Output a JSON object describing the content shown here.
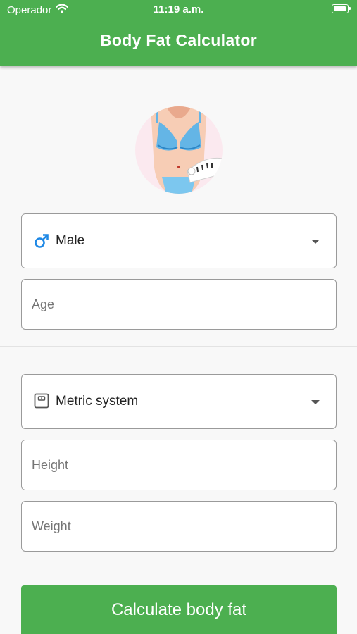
{
  "status_bar": {
    "carrier": "Operador",
    "time": "11:19 a.m.",
    "wifi_icon": "wifi-icon",
    "battery_icon": "battery-icon"
  },
  "header": {
    "title": "Body Fat Calculator",
    "color": "#4caf50"
  },
  "avatar": {
    "icon": "body-measure-illustration"
  },
  "gender_select": {
    "value": "Male",
    "icon": "male-symbol-icon",
    "icon_color": "#1e88e5"
  },
  "age_field": {
    "placeholder": "Age",
    "value": ""
  },
  "units_select": {
    "value": "Metric system",
    "icon": "scale-icon"
  },
  "height_field": {
    "placeholder": "Height",
    "value": ""
  },
  "weight_field": {
    "placeholder": "Weight",
    "value": ""
  },
  "calculate_button": {
    "label": "Calculate body fat",
    "color": "#4caf50"
  }
}
